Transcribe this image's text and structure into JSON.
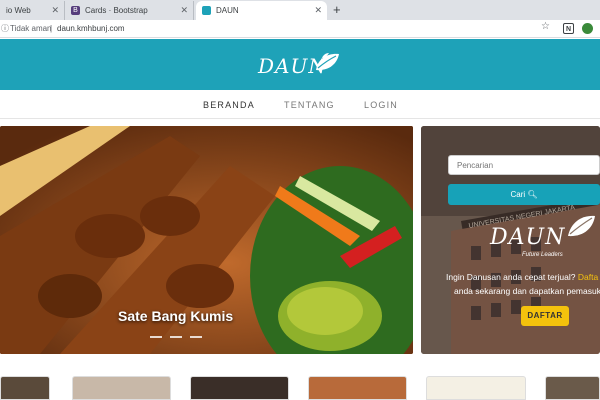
{
  "browser": {
    "tabs": [
      {
        "title": "io Web"
      },
      {
        "title": "Cards · Bootstrap"
      },
      {
        "title": "DAUN"
      }
    ],
    "new_tab": "+",
    "security_label": "Tidak aman",
    "url": "daun.kmhbunj.com"
  },
  "site": {
    "logo": "DAUN",
    "nav": [
      "BERANDA",
      "TENTANG",
      "LOGIN"
    ]
  },
  "carousel": {
    "caption": "Sate Bang Kumis",
    "next_glyph": "›"
  },
  "promo": {
    "search_placeholder": "Pencarian",
    "search_button": "Cari",
    "building_sign": "UNIVERSITAS NEGERI JAKARTA",
    "logo": "DAUN",
    "logo_sub": "Future Leaders",
    "line1_prefix": "Ingin Danusan anda cepat terjual?",
    "line1_highlight": "Dafta",
    "line2": "anda sekarang dan dapatkan pemasuk",
    "register_button": "DAFTAR"
  },
  "colors": {
    "header": "#1ea2b8",
    "accent": "#17a2b8",
    "highlight": "#f4c20d"
  }
}
